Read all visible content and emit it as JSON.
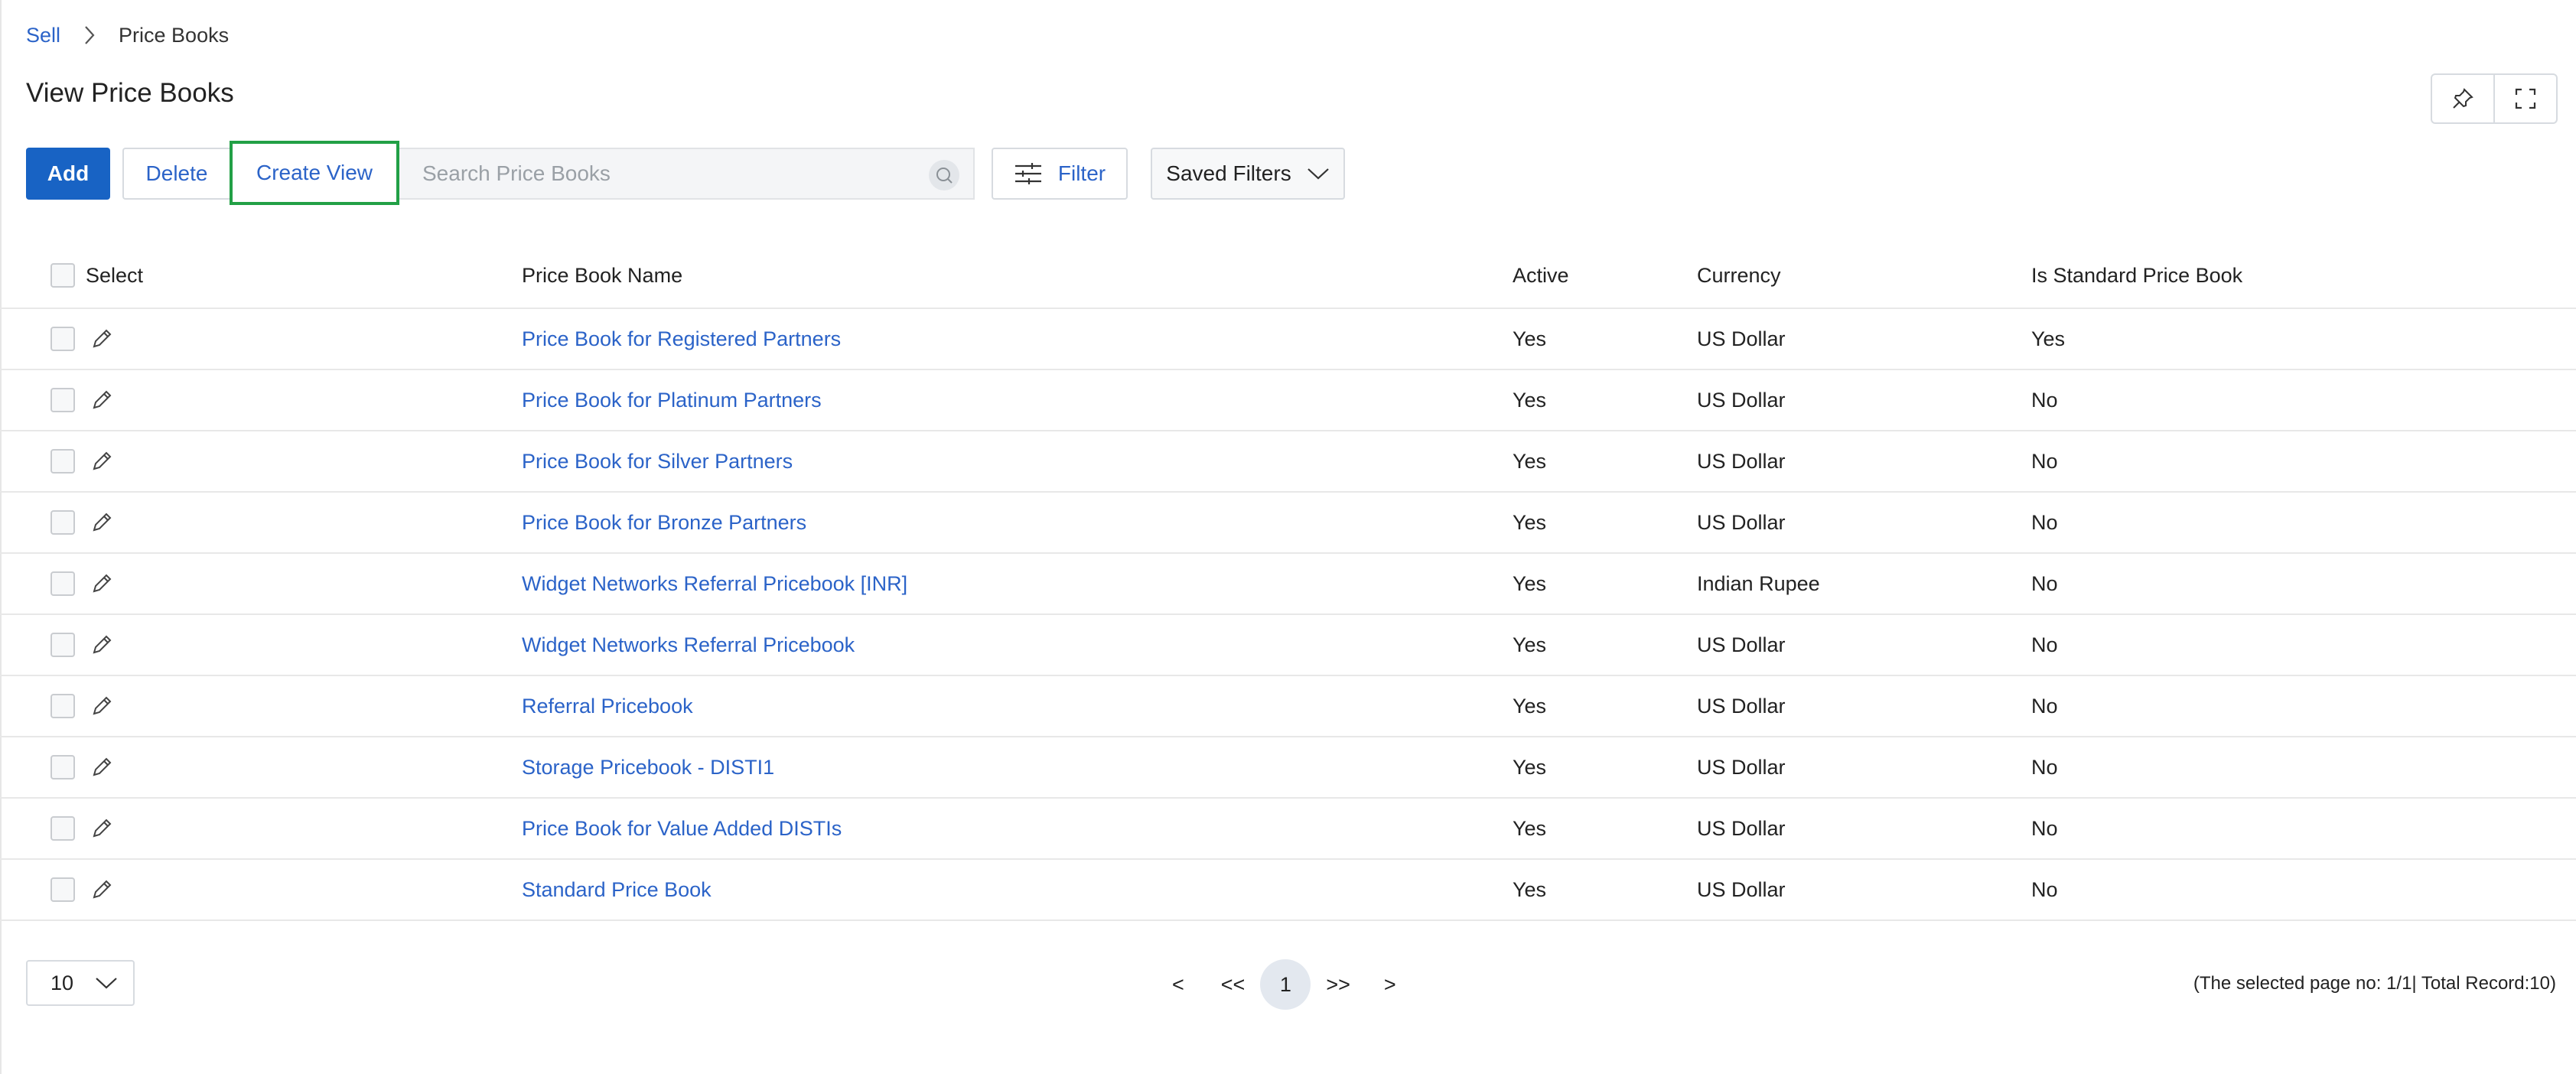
{
  "breadcrumb": {
    "parent": "Sell",
    "current": "Price Books"
  },
  "page": {
    "title": "View Price Books"
  },
  "toolbar": {
    "add_label": "Add",
    "delete_label": "Delete",
    "create_view_label": "Create View",
    "search_placeholder": "Search Price Books",
    "filter_label": "Filter",
    "saved_filters_label": "Saved Filters"
  },
  "table": {
    "columns": {
      "select": "Select",
      "name": "Price Book Name",
      "active": "Active",
      "currency": "Currency",
      "standard": "Is Standard Price Book"
    },
    "rows": [
      {
        "name": "Price Book for Registered Partners",
        "active": "Yes",
        "currency": "US Dollar",
        "standard": "Yes"
      },
      {
        "name": "Price Book for Platinum Partners",
        "active": "Yes",
        "currency": "US Dollar",
        "standard": "No"
      },
      {
        "name": "Price Book for Silver Partners",
        "active": "Yes",
        "currency": "US Dollar",
        "standard": "No"
      },
      {
        "name": "Price Book for Bronze Partners",
        "active": "Yes",
        "currency": "US Dollar",
        "standard": "No"
      },
      {
        "name": "Widget Networks Referral Pricebook [INR]",
        "active": "Yes",
        "currency": "Indian Rupee",
        "standard": "No"
      },
      {
        "name": "Widget Networks Referral Pricebook",
        "active": "Yes",
        "currency": "US Dollar",
        "standard": "No"
      },
      {
        "name": "Referral Pricebook",
        "active": "Yes",
        "currency": "US Dollar",
        "standard": "No"
      },
      {
        "name": "Storage Pricebook - DISTI1",
        "active": "Yes",
        "currency": "US Dollar",
        "standard": "No"
      },
      {
        "name": "Price Book for Value Added DISTIs",
        "active": "Yes",
        "currency": "US Dollar",
        "standard": "No"
      },
      {
        "name": "Standard Price Book",
        "active": "Yes",
        "currency": "US Dollar",
        "standard": "No"
      }
    ]
  },
  "pagination": {
    "page_size": "10",
    "prev": "<",
    "first": "<<",
    "current_page": "1",
    "last": ">>",
    "next": ">",
    "info": "(The selected page no: 1/1| Total Record:10)"
  },
  "colors": {
    "primary": "#1863c4",
    "link": "#2b63c8",
    "highlight": "#22a046"
  }
}
